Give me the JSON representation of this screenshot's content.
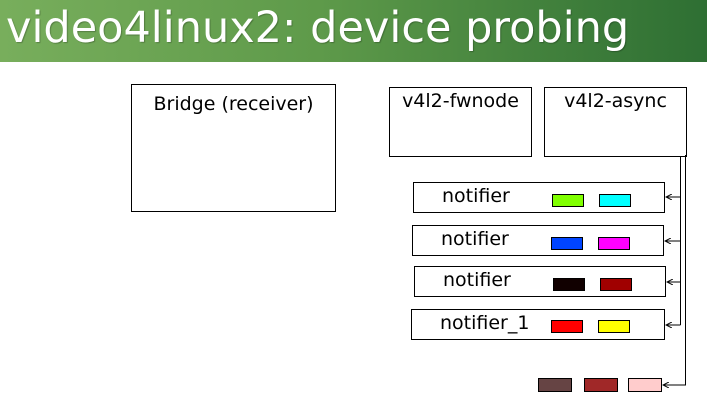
{
  "title": "video4linux2: device probing",
  "boxes": {
    "bridge": "Bridge (receiver)",
    "fwnode": "v4l2-fwnode",
    "async": "v4l2-async"
  },
  "notifiers": [
    {
      "label": "notifier",
      "colors": [
        "#80ff00",
        "#00ffff"
      ]
    },
    {
      "label": "notifier",
      "colors": [
        "#0044ff",
        "#ff00ff"
      ]
    },
    {
      "label": "notifier",
      "colors": [
        "#110000",
        "#a00000"
      ]
    },
    {
      "label": "notifier_1",
      "colors": [
        "#ff0000",
        "#ffff00"
      ]
    }
  ],
  "bottom_swatches": [
    "#664444",
    "#a02828",
    "#ffcccc"
  ],
  "colors": {
    "title_gradient": [
      "#78ae5c",
      "#2e6f33"
    ],
    "stroke": "#000000"
  }
}
